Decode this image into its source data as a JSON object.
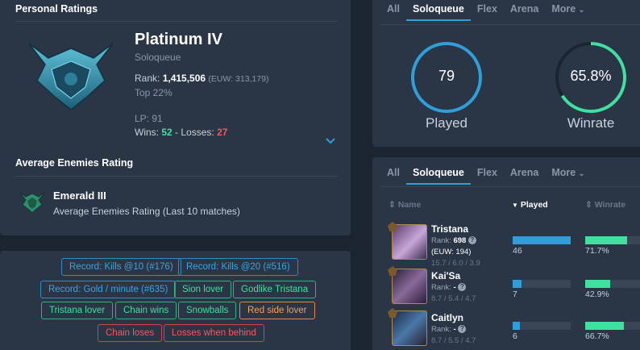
{
  "personal": {
    "title": "Personal Ratings",
    "tier": "Platinum IV",
    "queue": "Soloqueue",
    "rank_prefix": "Rank: ",
    "rank_value": "1,415,506",
    "rank_euw": "(EUW: 313,179)",
    "top": "Top 22%",
    "lp": "LP: 91",
    "wins_prefix": "Wins: ",
    "wins": "52",
    "sep": " - ",
    "losses_prefix": "Losses: ",
    "losses": "27"
  },
  "enemies": {
    "title": "Average Enemies Rating",
    "tier": "Emerald III",
    "desc": "Average Enemies Rating (Last 10 matches)"
  },
  "tags": [
    {
      "label": "Record: Kills @10 (#176)",
      "color": "blue"
    },
    {
      "label": "Record: Kills @20 (#516)",
      "color": "blue"
    },
    {
      "label": "Record: Gold / minute (#635)",
      "color": "blue"
    },
    {
      "label": "Sion lover",
      "color": "green"
    },
    {
      "label": "Godlike Tristana",
      "color": "green"
    },
    {
      "label": "Tristana lover",
      "color": "green"
    },
    {
      "label": "Chain wins",
      "color": "green"
    },
    {
      "label": "Snowballs",
      "color": "green"
    },
    {
      "label": "Red side lover",
      "color": "orange"
    },
    {
      "label": "Chain loses",
      "color": "red"
    },
    {
      "label": "Losses when behind",
      "color": "red"
    }
  ],
  "tabs_top": [
    "All",
    "Soloqueue",
    "Flex",
    "Arena",
    "More"
  ],
  "tabs_bottom": [
    "All",
    "Soloqueue",
    "Flex",
    "Arena",
    "More"
  ],
  "stats": {
    "played_value": "79",
    "played_label": "Played",
    "winrate_value": "65.8%",
    "winrate_label": "Winrate",
    "winrate_fraction": 0.658
  },
  "table": {
    "col_name": "Name",
    "col_played": "Played",
    "col_winrate": "Winrate",
    "rows": [
      {
        "name": "Tristana",
        "rank_prefix": "Rank: ",
        "rank": "698",
        "euw": "(EUW: 194)",
        "kda": "15.7 / 6.0 / 3.9",
        "played": "46",
        "played_fraction": 1.0,
        "winrate": "71.7%",
        "winrate_fraction": 0.717
      },
      {
        "name": "Kai'Sa",
        "rank_prefix": "Rank: ",
        "rank": "-",
        "kda": "8.7 / 5.4 / 4.7",
        "played": "7",
        "played_fraction": 0.152,
        "winrate": "42.9%",
        "winrate_fraction": 0.429
      },
      {
        "name": "Caitlyn",
        "rank_prefix": "Rank: ",
        "rank": "-",
        "kda": "8.7 / 5.5 / 4.7",
        "played": "6",
        "played_fraction": 0.13,
        "winrate": "66.7%",
        "winrate_fraction": 0.667
      }
    ]
  },
  "colors": {
    "accent_blue": "#2e9fd8",
    "win_green": "#3fe0a0",
    "loss_red": "#f05a62"
  }
}
